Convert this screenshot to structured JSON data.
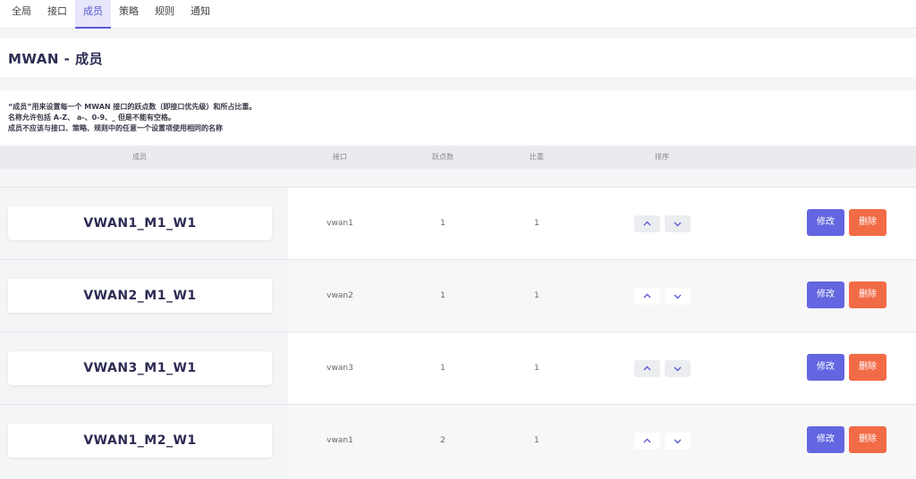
{
  "tabs": [
    {
      "label": "全局",
      "active": false
    },
    {
      "label": "接口",
      "active": false
    },
    {
      "label": "成员",
      "active": true
    },
    {
      "label": "策略",
      "active": false
    },
    {
      "label": "规则",
      "active": false
    },
    {
      "label": "通知",
      "active": false
    }
  ],
  "page_title": "MWAN - 成员",
  "description": [
    "“成员”用来设置每一个 MWAN 接口的跃点数（即接口优先级）和所占比重。",
    "名称允许包括 A-Z、 a-、0-9、_ 但是不能有空格。",
    "成员不应该与接口、策略、规则中的任意一个设置项使用相同的名称"
  ],
  "table": {
    "headers": {
      "member": "成员",
      "interface": "接口",
      "metric": "跃点数",
      "weight": "比重",
      "sort": "排序"
    },
    "rows": [
      {
        "name": "VWAN1_M1_W1",
        "interface": "vwan1",
        "metric": "1",
        "weight": "1"
      },
      {
        "name": "VWAN2_M1_W1",
        "interface": "vwan2",
        "metric": "1",
        "weight": "1"
      },
      {
        "name": "VWAN3_M1_W1",
        "interface": "vwan3",
        "metric": "1",
        "weight": "1"
      },
      {
        "name": "VWAN1_M2_W1",
        "interface": "vwan1",
        "metric": "2",
        "weight": "1"
      }
    ],
    "edit_label": "修改",
    "delete_label": "删除"
  },
  "colors": {
    "accent": "#6366e0",
    "danger": "#f26b47",
    "title": "#2c2c54"
  },
  "icons": {
    "up": "chevron-up-icon",
    "down": "chevron-down-icon"
  }
}
